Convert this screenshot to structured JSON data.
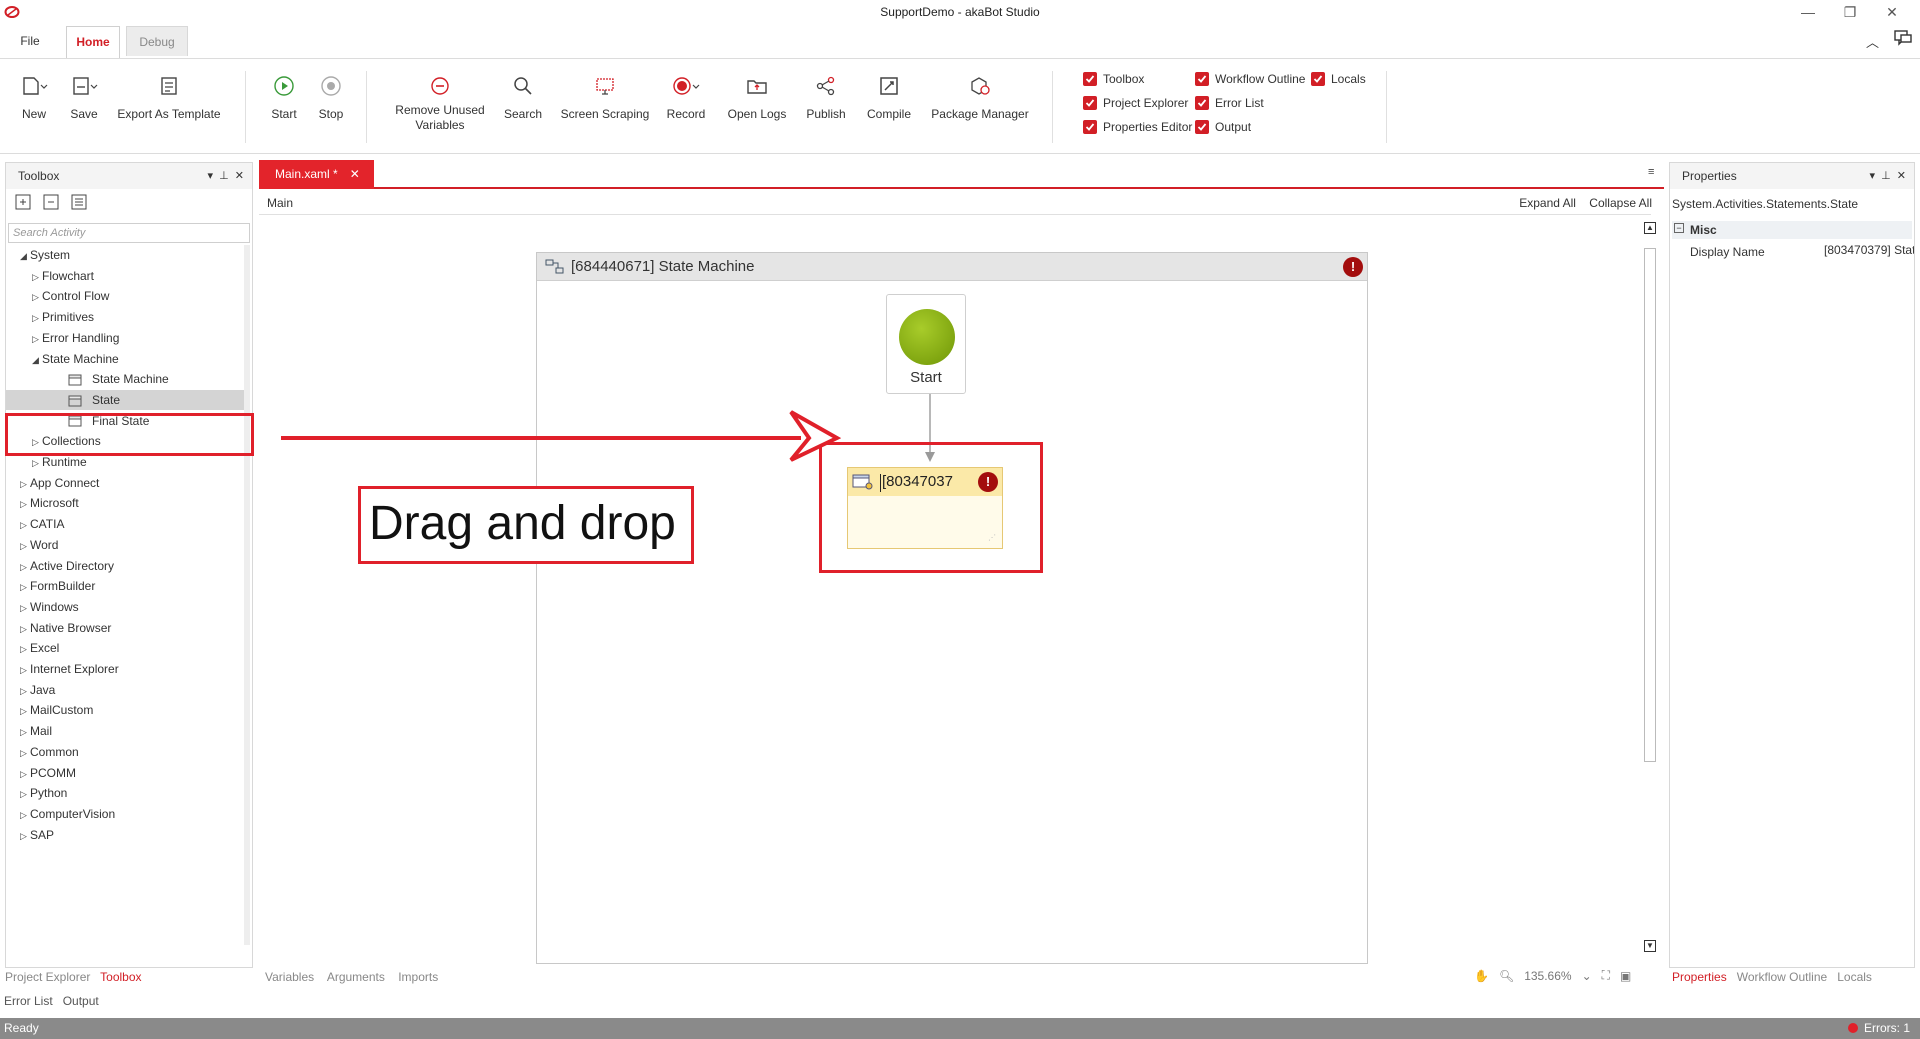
{
  "window": {
    "title": "SupportDemo - akaBot Studio",
    "minimize": "—",
    "restore": "❐",
    "close": "✕"
  },
  "ribbon_tabs": [
    "File",
    "Home",
    "Debug"
  ],
  "ribbon": {
    "new": "New",
    "save": "Save",
    "export_template": "Export As Template",
    "start": "Start",
    "stop": "Stop",
    "remove_unused_1": "Remove Unused",
    "remove_unused_2": "Variables",
    "search": "Search",
    "screen_scraping": "Screen Scraping",
    "record": "Record",
    "open_logs": "Open Logs",
    "publish": "Publish",
    "compile": "Compile",
    "package_manager": "Package Manager",
    "checks": {
      "toolbox": "Toolbox",
      "project_explorer": "Project Explorer",
      "properties_editor": "Properties Editor",
      "workflow_outline": "Workflow Outline",
      "error_list": "Error List",
      "output": "Output",
      "locals": "Locals"
    }
  },
  "toolbox": {
    "title": "Toolbox",
    "search_placeholder": "Search Activity",
    "tree": [
      {
        "label": "System",
        "level": 1,
        "expanded": true
      },
      {
        "label": "Flowchart",
        "level": 2,
        "expanded": false
      },
      {
        "label": "Control Flow",
        "level": 2,
        "expanded": false
      },
      {
        "label": "Primitives",
        "level": 2,
        "expanded": false
      },
      {
        "label": "Error Handling",
        "level": 2,
        "expanded": false
      },
      {
        "label": "State Machine",
        "level": 2,
        "expanded": true
      },
      {
        "label": "State Machine",
        "level": 3,
        "icon": "state-machine-icon"
      },
      {
        "label": "State",
        "level": 3,
        "icon": "state-icon",
        "selected": true
      },
      {
        "label": "Final State",
        "level": 3,
        "icon": "final-state-icon"
      },
      {
        "label": "Collections",
        "level": 2,
        "expanded": false
      },
      {
        "label": "Runtime",
        "level": 2,
        "expanded": false
      },
      {
        "label": "App Connect",
        "level": 1,
        "expanded": false
      },
      {
        "label": "Microsoft",
        "level": 1,
        "expanded": false
      },
      {
        "label": "CATIA",
        "level": 1,
        "expanded": false
      },
      {
        "label": "Word",
        "level": 1,
        "expanded": false
      },
      {
        "label": "Active Directory",
        "level": 1,
        "expanded": false
      },
      {
        "label": "FormBuilder",
        "level": 1,
        "expanded": false
      },
      {
        "label": "Windows",
        "level": 1,
        "expanded": false
      },
      {
        "label": "Native Browser",
        "level": 1,
        "expanded": false
      },
      {
        "label": "Excel",
        "level": 1,
        "expanded": false
      },
      {
        "label": "Internet Explorer",
        "level": 1,
        "expanded": false
      },
      {
        "label": "Java",
        "level": 1,
        "expanded": false
      },
      {
        "label": "MailCustom",
        "level": 1,
        "expanded": false
      },
      {
        "label": "Mail",
        "level": 1,
        "expanded": false
      },
      {
        "label": "Common",
        "level": 1,
        "expanded": false
      },
      {
        "label": "PCOMM",
        "level": 1,
        "expanded": false
      },
      {
        "label": "Python",
        "level": 1,
        "expanded": false
      },
      {
        "label": "ComputerVision",
        "level": 1,
        "expanded": false
      },
      {
        "label": "SAP",
        "level": 1,
        "expanded": false
      }
    ]
  },
  "editor": {
    "tab": "Main.xaml *",
    "breadcrumb": "Main",
    "expand_all": "Expand All",
    "collapse_all": "Collapse All",
    "state_machine_title": "[684440671] State Machine",
    "start_label": "Start",
    "state_label": "[80347037",
    "annotation": "Drag and drop",
    "bottom_tabs": [
      "Variables",
      "Arguments",
      "Imports"
    ],
    "zoom": "135.66%"
  },
  "properties": {
    "title": "Properties",
    "type": "System.Activities.Statements.State",
    "category": "Misc",
    "display_name_label": "Display Name",
    "display_name_value": "[803470379] Stat",
    "bottom_tabs": [
      "Properties",
      "Workflow Outline",
      "Locals"
    ]
  },
  "bottom_left_tabs": [
    "Project Explorer",
    "Toolbox"
  ],
  "bottom_left_tabs2": [
    "Error List",
    "Output"
  ],
  "status": {
    "text": "Ready",
    "errors": "Errors: 1"
  },
  "colors": {
    "accent": "#d21f26",
    "error": "#a30d0d",
    "start_green": "#7ea40a",
    "state_header": "#fbe9a8"
  }
}
